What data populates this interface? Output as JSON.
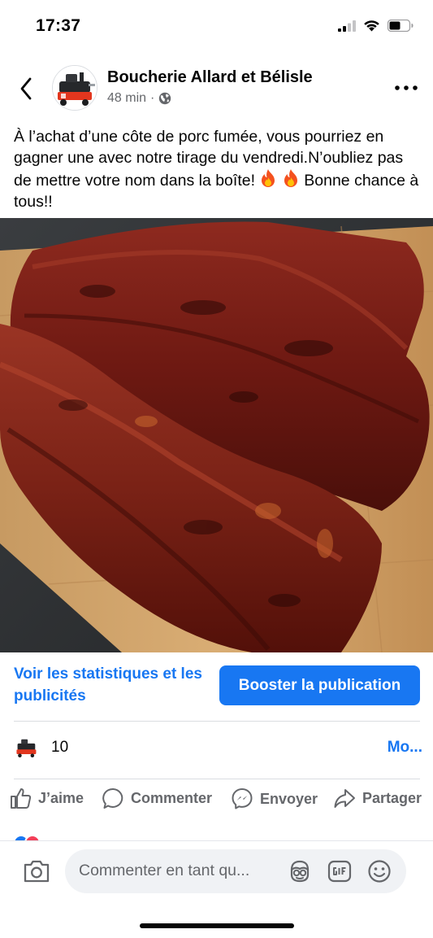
{
  "status_bar": {
    "time": "17:37",
    "icons": [
      "cellular-signal-icon",
      "wifi-icon",
      "battery-icon"
    ]
  },
  "post": {
    "back_icon": "chevron-left-icon",
    "page_name": "Boucherie Allard et Bélisle",
    "time_ago": "48 min",
    "separator": "·",
    "audience_icon": "globe-icon",
    "more_icon": "ellipsis-icon",
    "text_part1": "À l’achat d’une côte de porc fumée, vous pourriez en gagner une avec notre tirage du vendredi.N’oubliez pas de mettre votre nom dans la boîte! ",
    "text_part2": " Bonne chance à tous!!",
    "emoji": "fire-emoji",
    "image_subject": "ribs-photo"
  },
  "actions_bar": {
    "stats_link": "Voir les statistiques et les publicités",
    "boost_label": "Booster la publication"
  },
  "reactions": {
    "count": "10",
    "more_label": "Mo..."
  },
  "buttons": {
    "like": "J’aime",
    "comment": "Commenter",
    "send": "Envoyer",
    "share": "Partager"
  },
  "composer": {
    "placeholder": "Commenter en tant qu...",
    "icons": [
      "camera-icon",
      "avatar-sticker-icon",
      "gif-icon",
      "emoji-icon"
    ]
  },
  "colors": {
    "accent": "#1877f2",
    "secondary_text": "#65676b",
    "input_bg": "#f0f2f5"
  }
}
